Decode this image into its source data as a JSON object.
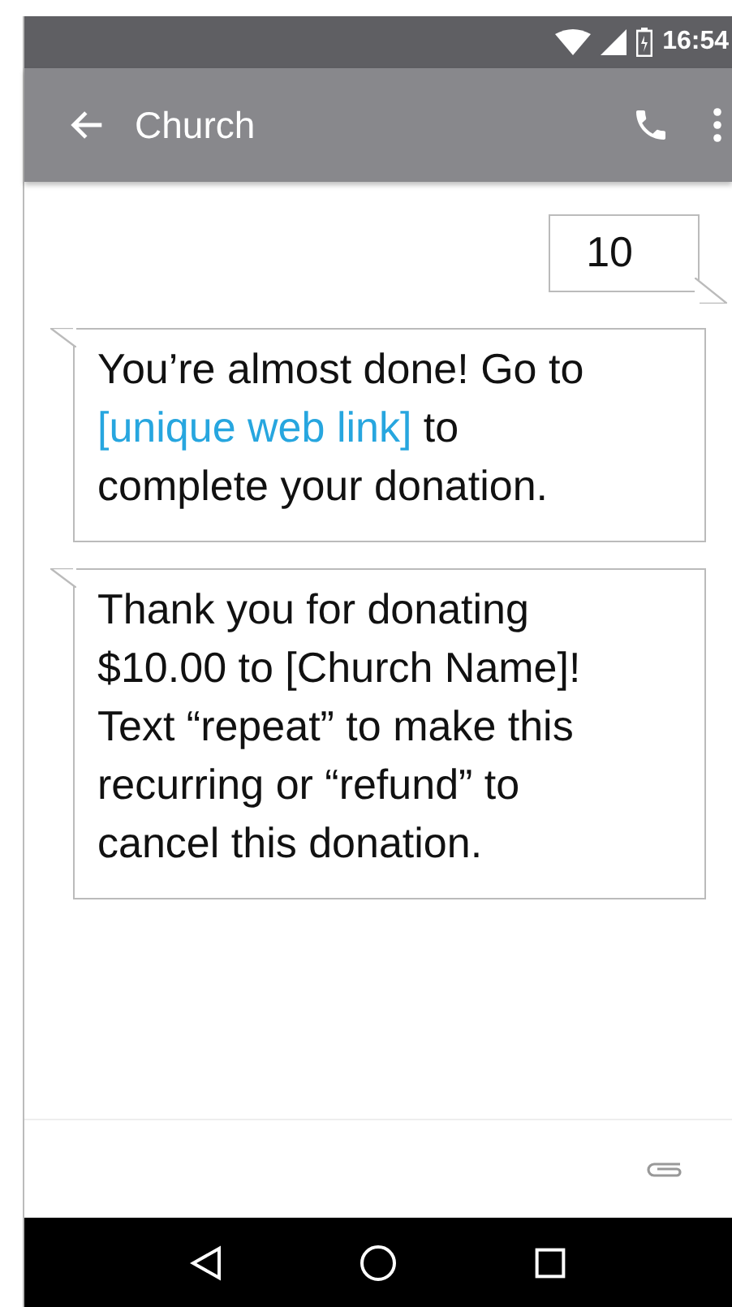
{
  "status_bar": {
    "time": "16:54"
  },
  "app_bar": {
    "title": "Church"
  },
  "messages": [
    {
      "kind": "outgoing",
      "parts": [
        {
          "kind": "text",
          "text": "10"
        }
      ]
    },
    {
      "kind": "incoming",
      "parts": [
        {
          "kind": "text",
          "text": "You’re almost done! Go to "
        },
        {
          "kind": "link",
          "text": "[unique web link]"
        },
        {
          "kind": "text",
          "text": " to complete your donation."
        }
      ]
    },
    {
      "kind": "incoming",
      "parts": [
        {
          "kind": "text",
          "text": "Thank you for donating $10.00 to [Church Name]! Text “repeat” to make this recurring or “refund” to cancel this donation."
        }
      ]
    }
  ]
}
